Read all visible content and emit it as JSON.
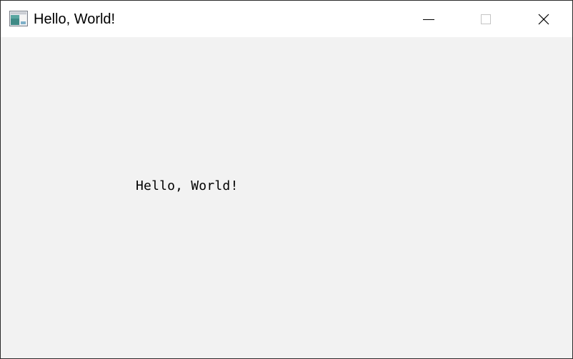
{
  "window": {
    "title": "Hello, World!",
    "icon": "app-window-icon",
    "controls": {
      "minimize_icon": "minimize-icon",
      "maximize_icon": "maximize-icon",
      "close_icon": "close-icon"
    }
  },
  "content": {
    "label": "Hello, World!"
  },
  "colors": {
    "titlebar_bg": "#ffffff",
    "client_bg": "#f2f2f2",
    "border": "#2b2b2b",
    "text": "#000000"
  }
}
